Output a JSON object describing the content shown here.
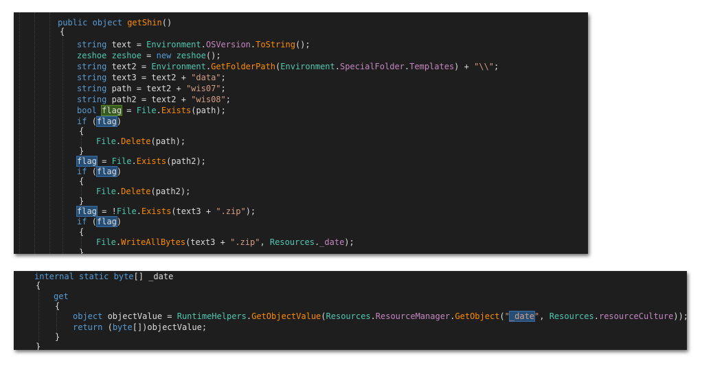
{
  "panel1": {
    "lines": [
      [
        "public object getShin()"
      ],
      [
        "{"
      ],
      [
        "string text = Environment.OSVersion.ToString();"
      ],
      [
        "zeshoe zeshoe = new zeshoe();"
      ],
      [
        "string text2 = Environment.GetFolderPath(Environment.SpecialFolder.Templates) + \"\\\\\";"
      ],
      [
        "string text3 = text2 + \"data\";"
      ],
      [
        "string path = text2 + \"wis07\";"
      ],
      [
        "string path2 = text2 + \"wis08\";"
      ],
      [
        "bool flag = File.Exists(path);"
      ],
      [
        "if (flag)"
      ],
      [
        "{"
      ],
      [
        "File.Delete(path);"
      ],
      [
        "}"
      ],
      [
        "flag = File.Exists(path2);"
      ],
      [
        "if (flag)"
      ],
      [
        "{"
      ],
      [
        "File.Delete(path2);"
      ],
      [
        "}"
      ],
      [
        "flag = !File.Exists(text3 + \".zip\");"
      ],
      [
        "if (flag)"
      ],
      [
        "{"
      ],
      [
        "File.WriteAllBytes(text3 + \".zip\", Resources._date);"
      ],
      [
        "}"
      ]
    ]
  },
  "panel2": {
    "lines": [
      [
        "internal static byte[] _date"
      ],
      [
        "{"
      ],
      [
        "get"
      ],
      [
        "{"
      ],
      [
        "object objectValue = RuntimeHelpers.GetObjectValue(Resources.ResourceManager.GetObject(\"_date\", Resources.resourceCulture));"
      ],
      [
        "return (byte[])objectValue;"
      ],
      [
        "}"
      ],
      [
        "}"
      ]
    ]
  },
  "colors": {
    "background": "#1e1e1e",
    "keyword": "#569cd6",
    "type": "#4ec9b0",
    "method": "#ff8c00",
    "property": "#c586c0",
    "string": "#d69d85",
    "highlight": "#264f78",
    "highlight_active": "#375a1f"
  }
}
